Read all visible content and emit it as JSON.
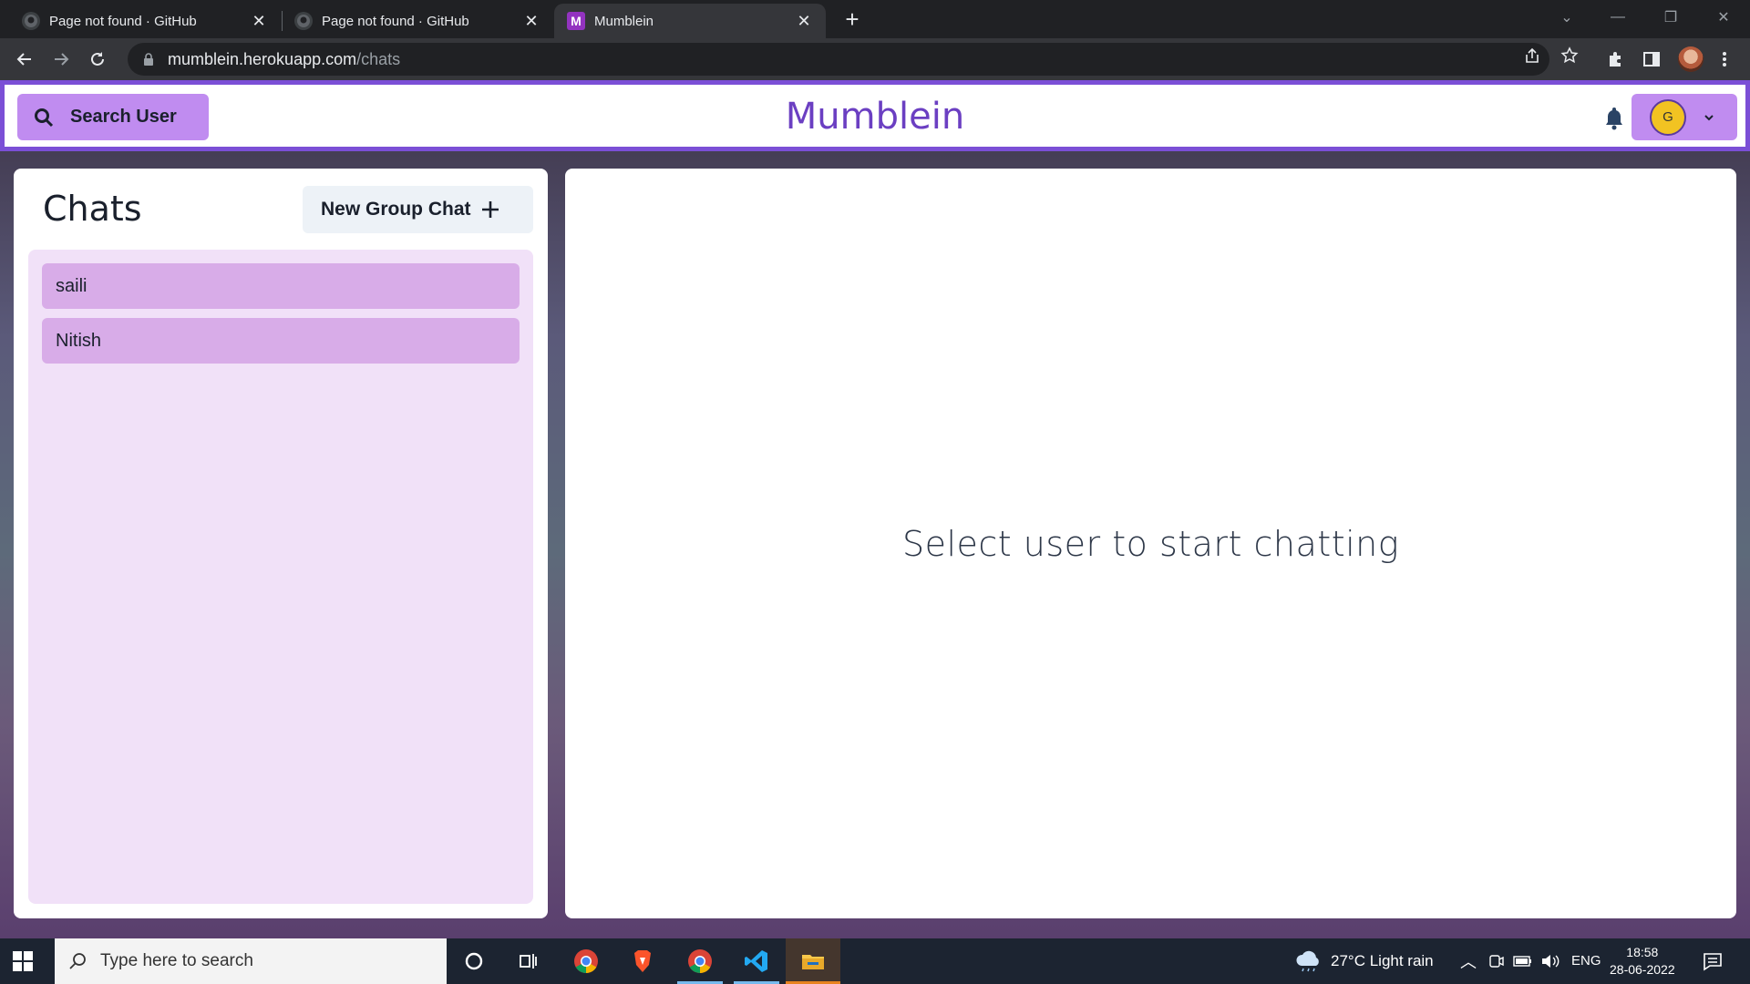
{
  "browser": {
    "tabs": [
      {
        "title": "Page not found · GitHub"
      },
      {
        "title": "Page not found · GitHub"
      },
      {
        "title": "Mumblein",
        "favicon_letter": "M"
      }
    ],
    "url_host": "mumblein.herokuapp.com",
    "url_path": "/chats"
  },
  "header": {
    "search_label": "Search User",
    "brand": "Mumblein",
    "avatar_initial": "G"
  },
  "sidebar": {
    "title": "Chats",
    "new_group_label": "New Group Chat",
    "chats": [
      {
        "name": "saili"
      },
      {
        "name": "Nitish"
      }
    ]
  },
  "chat_area": {
    "empty_message": "Select user to start chatting"
  },
  "taskbar": {
    "search_placeholder": "Type here to search",
    "weather": "27°C  Light rain",
    "language": "ENG",
    "time": "18:58",
    "date": "28-06-2022"
  },
  "colors": {
    "accent": "#7b4fd6",
    "button": "#c08cf0",
    "chat_item": "#d8ace8",
    "chat_list_bg": "#f1e1f8"
  }
}
